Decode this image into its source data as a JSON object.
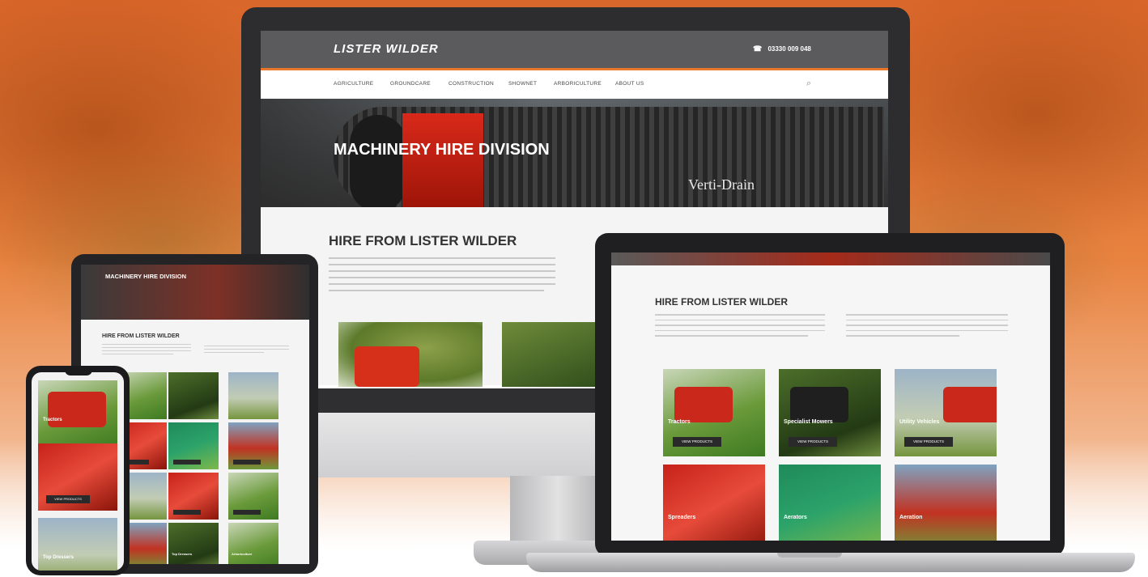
{
  "desktop": {
    "logo": "LISTER WILDER",
    "phone": "03330 009 048",
    "nav": [
      "AGRICULTURE",
      "GROUNDCARE",
      "CONSTRUCTION",
      "SHOWNET",
      "ARBORICULTURE",
      "ABOUT US"
    ],
    "hero_title": "MACHINERY HIRE DIVISION",
    "hero_brand": "Verti-Drain",
    "section_title": "HIRE FROM LISTER WILDER"
  },
  "laptop": {
    "section_title": "HIRE FROM LISTER WILDER",
    "tiles": [
      {
        "label": "Tractors",
        "button": "VIEW PRODUCTS"
      },
      {
        "label": "Specialist Mowers",
        "button": "VIEW PRODUCTS"
      },
      {
        "label": "Utility Vehicles",
        "button": "VIEW PRODUCTS"
      },
      {
        "label": "Spreaders",
        "button": ""
      },
      {
        "label": "Aerators",
        "button": ""
      },
      {
        "label": "Aeration",
        "button": ""
      }
    ]
  },
  "tablet": {
    "hero_title": "MACHINERY HIRE DIVISION",
    "section_title": "HIRE FROM LISTER WILDER",
    "tiles": [
      "",
      "",
      "",
      "",
      "",
      "",
      "",
      "",
      "",
      "",
      "Top Dressers",
      "Arboriculture"
    ]
  },
  "phone": {
    "tiles": [
      {
        "label": "Tractors",
        "button": ""
      },
      {
        "label": "",
        "button": "VIEW PRODUCTS"
      },
      {
        "label": "Top Dressers",
        "button": ""
      }
    ]
  },
  "colors": {
    "accent": "#e8782a",
    "brand_red": "#d6301a",
    "header_gray": "#5b5b5d"
  }
}
